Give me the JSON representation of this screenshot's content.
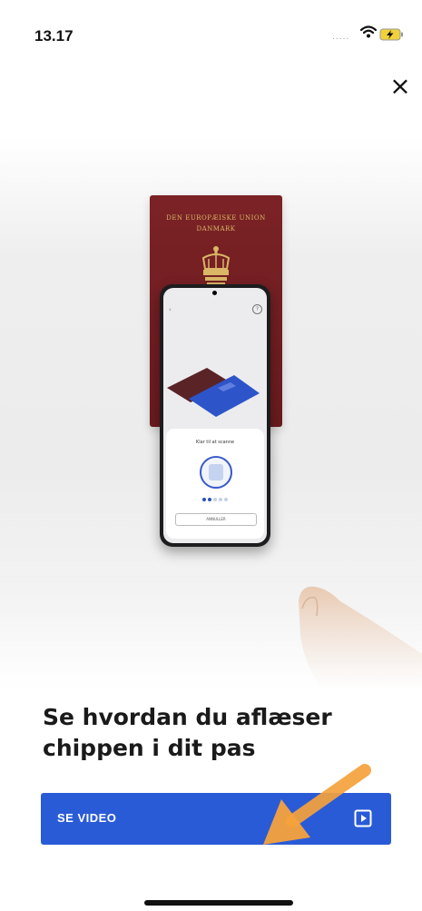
{
  "status_bar": {
    "time": "13.17",
    "signal": "....."
  },
  "passport": {
    "line1": "DEN EUROPÆISKE UNION",
    "line2": "DANMARK"
  },
  "inner_screen": {
    "sheet_title": "Klar til at scanne",
    "cancel_label": "ANNULLER"
  },
  "close_label": "×",
  "heading": "Se hvordan du aflæser chippen i dit pas",
  "video_button": {
    "label": "SE VIDEO"
  },
  "colors": {
    "accent": "#2a5bd7",
    "passport": "#7b2226",
    "arrow": "#f5a23c"
  },
  "icons": [
    "wifi-icon",
    "battery-charging-icon",
    "close-icon",
    "play-icon",
    "crown-crest-icon"
  ]
}
